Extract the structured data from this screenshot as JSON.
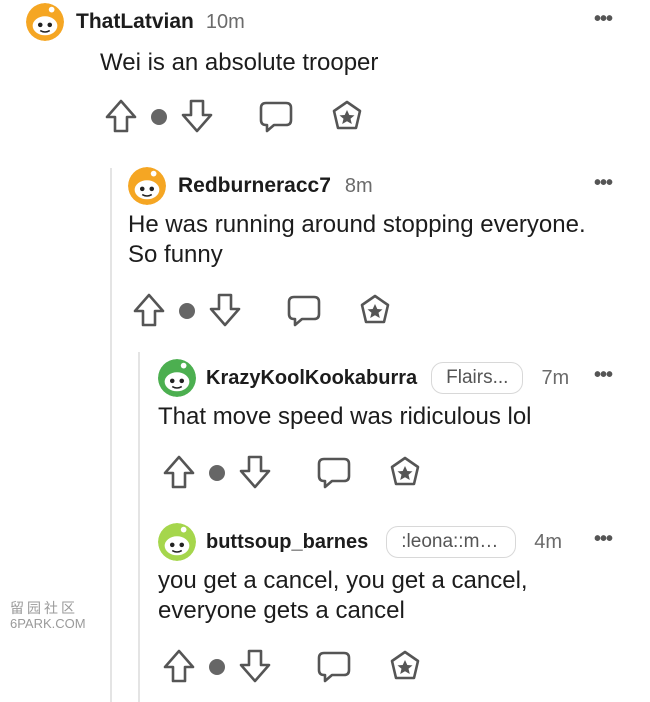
{
  "comments": [
    {
      "username": "ThatLatvian",
      "time": "10m",
      "flair": "",
      "body_lines": [
        "Wei is an absolute trooper"
      ],
      "more_label": "•••"
    },
    {
      "username": "Redburneracc7",
      "time": "8m",
      "flair": "",
      "body_lines": [
        "He was running around stopping everyone.",
        "So funny"
      ],
      "more_label": "•••"
    },
    {
      "username": "KrazyKoolKookaburra",
      "time": "7m",
      "flair": "Flairs...",
      "body_lines": [
        "That move speed was ridiculous lol"
      ],
      "more_label": "•••"
    },
    {
      "username": "buttsoup_barnes",
      "time": "4m",
      "flair": ":leona::mo...",
      "body_lines": [
        "you get a cancel, you get a cancel,",
        "everyone gets a cancel"
      ],
      "more_label": "•••"
    }
  ],
  "icons": {
    "upvote": "upvote-arrow-icon",
    "downvote": "downvote-arrow-icon",
    "vote_dot": "vote-dot-icon",
    "reply": "reply-bubble-icon",
    "award": "award-star-icon"
  },
  "colors": {
    "avatar_orange": "#f5a623",
    "avatar_green": "#4caf50",
    "avatar_lime": "#a5d64c",
    "icon_gray": "#555555"
  },
  "watermark": {
    "glyphs": "留园社区",
    "text": "6PARK.COM"
  }
}
